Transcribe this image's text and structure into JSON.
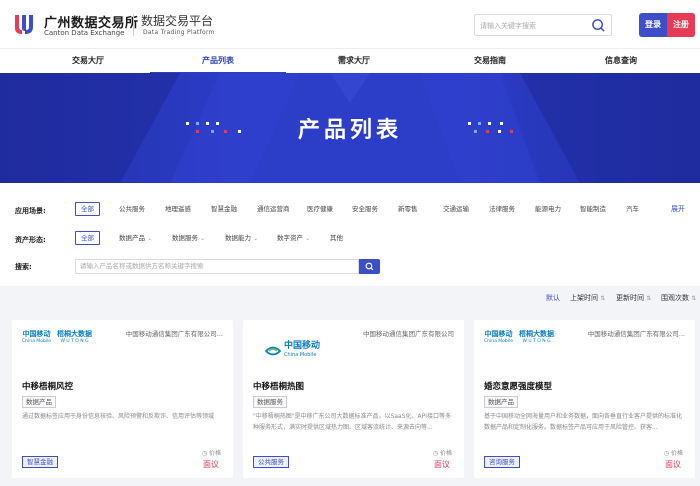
{
  "header": {
    "logo_cn": "广州数据交易所",
    "logo_en": "Canton Data Exchange",
    "platform_cn": "数据交易平台",
    "platform_en": "Data Trading Platform",
    "search_placeholder": "请输入关键字搜索",
    "login": "登录",
    "register": "注册"
  },
  "nav": [
    {
      "label": "交易大厅"
    },
    {
      "label": "产品列表"
    },
    {
      "label": "需求大厅"
    },
    {
      "label": "交易指南"
    },
    {
      "label": "信息查询"
    }
  ],
  "banner": {
    "title": "产品列表"
  },
  "filters": {
    "app_label": "应用场景:",
    "app_options": [
      "全部",
      "公共服务",
      "地理遥感",
      "智慧金融",
      "通信运营商",
      "医疗健康",
      "安全服务",
      "新零售",
      "交通运输",
      "法律服务",
      "能源电力",
      "智能制造",
      "汽车"
    ],
    "expand": "展开",
    "asset_label": "资产形态:",
    "asset_options": [
      "全部",
      "数据产品",
      "数据服务",
      "数据能力",
      "数字资产",
      "其他"
    ],
    "search_label": "搜索:",
    "search_placeholder": "请输入产品名称或数据供方名称关键字搜索"
  },
  "sort": [
    "默认",
    "上架时间",
    "更新时间",
    "围观次数"
  ],
  "cards": [
    {
      "company": "中国移动通信集团广东有限公司...",
      "logo1": "中国移动",
      "logo1_sub": "China Mobile",
      "logo2": "梧桐大数据",
      "logo2_sub": "W U T O N G",
      "title": "中移梧桐风控",
      "type": "数据产品",
      "desc": "通过数据标签应用于身份信息核验、风险预警和反欺诈、信用评估等领域",
      "tag": "智慧金融",
      "price_label": "价格",
      "price": "面议"
    },
    {
      "company": "中国移动通信集团广东有限公司",
      "logo1": "中国移动",
      "logo1_sub": "China Mobile",
      "title": "中移梧桐热图",
      "type": "数据服务",
      "desc": "\"中移梧桐热图\"是中移广东公司大数据标准产品，以SaaS化、API接口等多种服务形式，满实时提供区域热力图、区域客流统计、来源去向等...",
      "tag": "公共服务",
      "price_label": "价格",
      "price": "面议"
    },
    {
      "company": "中国移动通信集团广东有限公司...",
      "logo1": "中国移动",
      "logo1_sub": "China Mobile",
      "logo2": "梧桐大数据",
      "logo2_sub": "W U T O N G",
      "title": "婚恋意愿强度模型",
      "type": "数据产品",
      "desc": "基于中国移动全网海量用户和业务数据，面向各垂直行业客户提供的标准化数据产品和定制化服务。数据标签产品可应用于风险管控、获客...",
      "tag": "咨询服务",
      "price_label": "价格",
      "price": "面议"
    }
  ],
  "colors": {
    "brand_blue": "#3d4ec9",
    "accent_red": "#e63a55",
    "banner_blue": "#2c3dc8"
  }
}
